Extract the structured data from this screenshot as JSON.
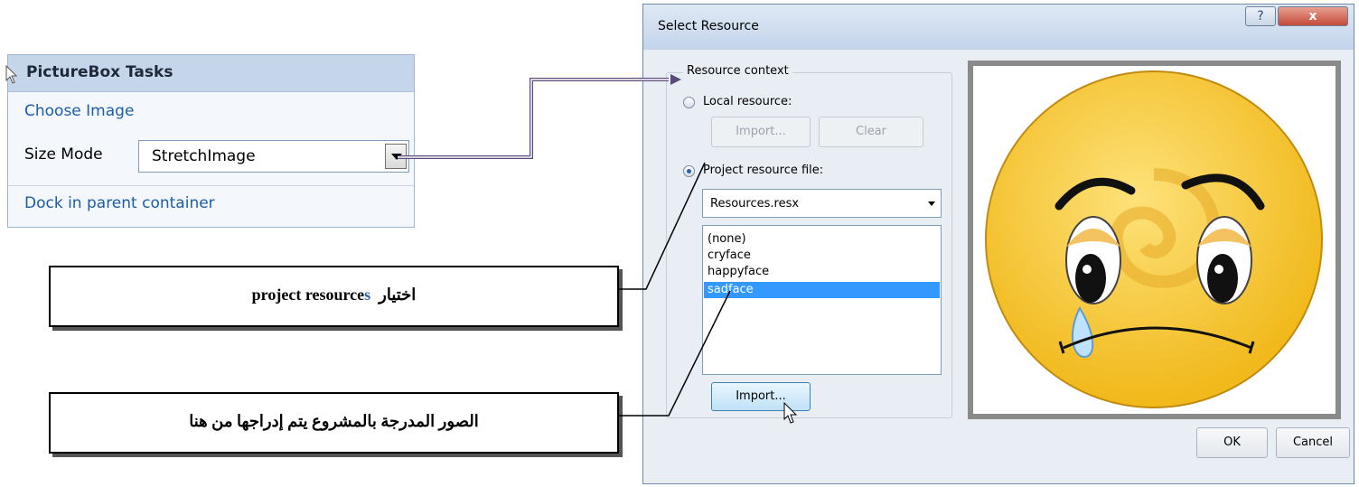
{
  "tasks_panel": {
    "title": "PictureBox Tasks",
    "choose_image": "Choose Image",
    "size_mode_label": "Size Mode",
    "size_mode_value": "StretchImage",
    "dock": "Dock in parent container"
  },
  "callouts": {
    "first_arabic": "اختيار",
    "first_plain": "project resource",
    "first_accent": "s",
    "second": "الصور المدرجة بالمشروع يتم إدراجها من هنا"
  },
  "dialog": {
    "title": "Select Resource",
    "help": "?",
    "close": "x",
    "context_label": "Resource context",
    "local_resource": "Local resource:",
    "import_local": "Import...",
    "clear": "Clear",
    "project_resource": "Project resource file:",
    "resource_file": "Resources.resx",
    "list_items": [
      "(none)",
      "cryface",
      "happyface",
      "sadface"
    ],
    "selected_item": "sadface",
    "import_project": "Import...",
    "ok": "OK",
    "cancel": "Cancel"
  },
  "colors": {
    "face": "#f5c83a",
    "selection": "#3399ff",
    "connector": "#5a4a7a"
  }
}
